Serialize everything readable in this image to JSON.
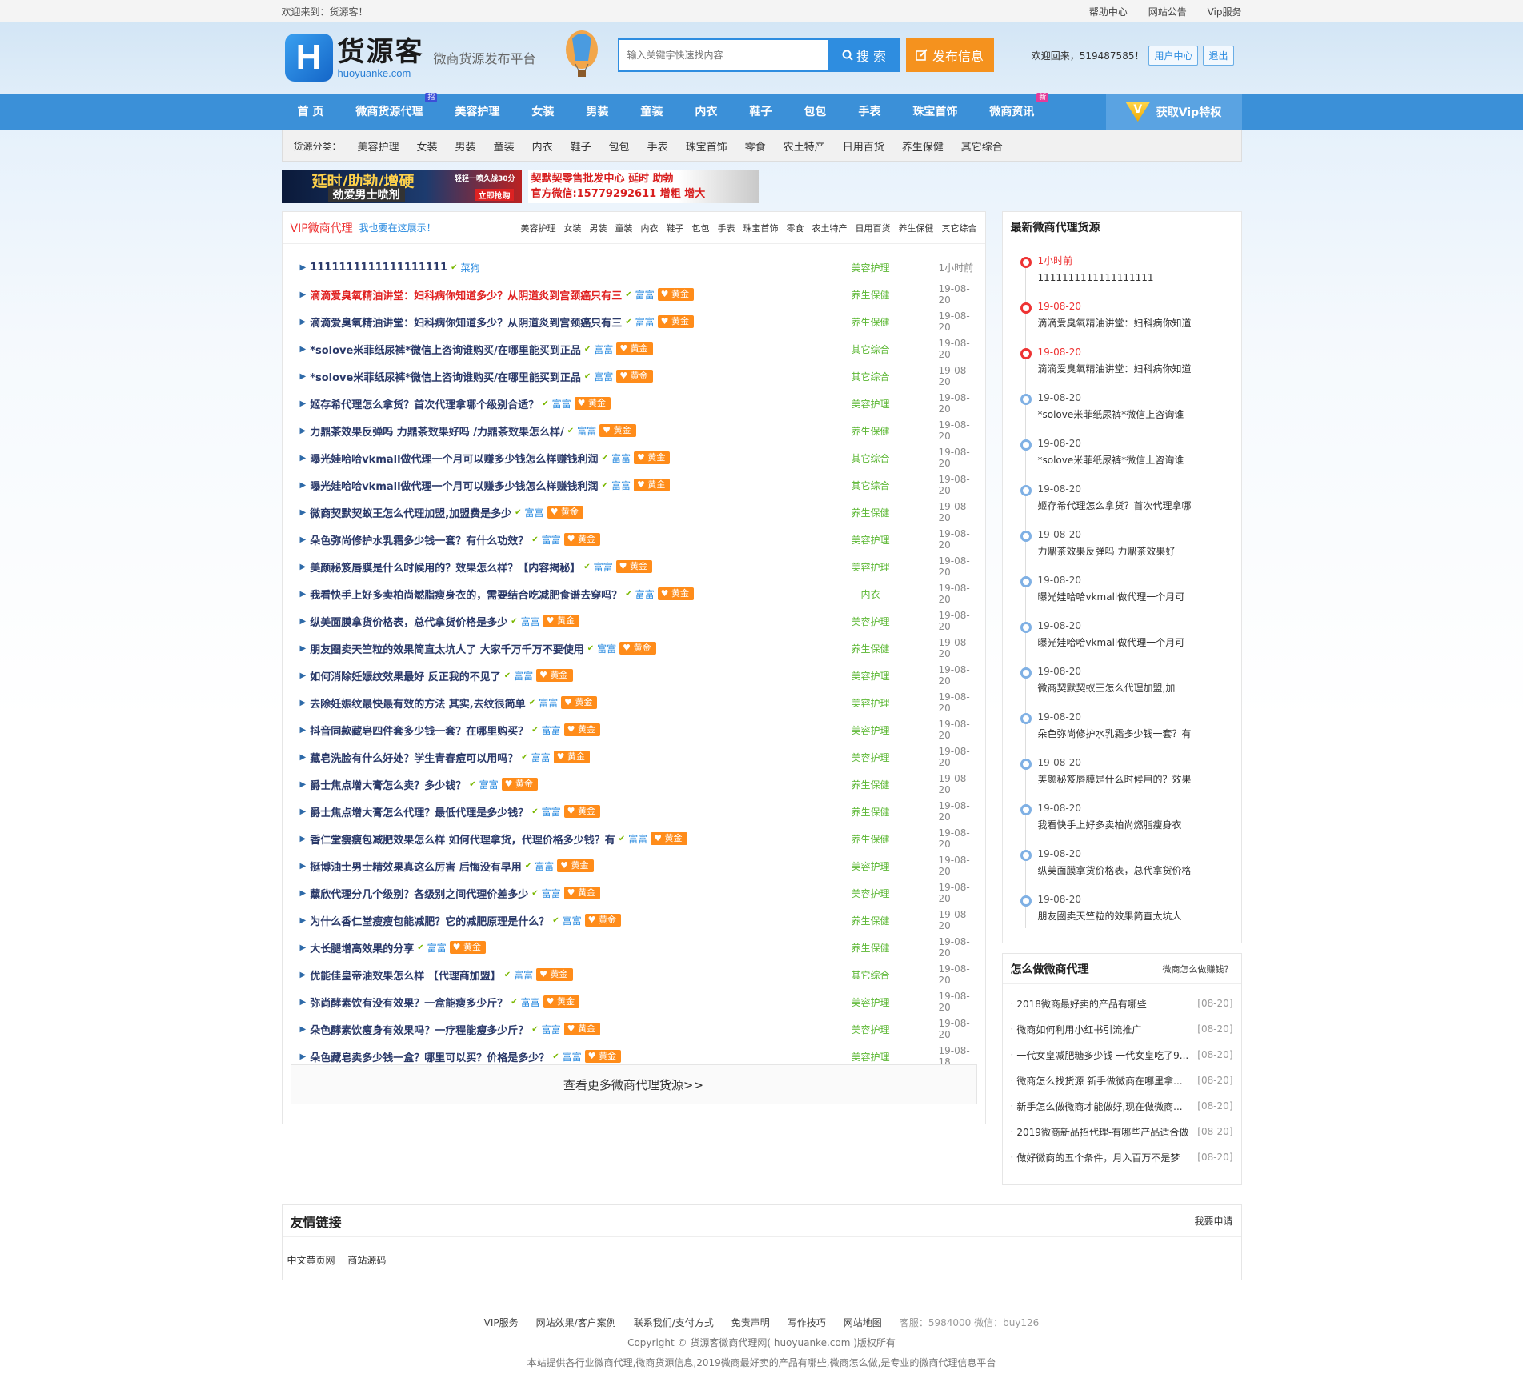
{
  "topbar": {
    "welcome": "欢迎来到：货源客！",
    "links": [
      "帮助中心",
      "网站公告",
      "Vip服务"
    ]
  },
  "header": {
    "logo_letter": "H",
    "logo_cn": "货源客",
    "logo_en": "huoyuanke.com",
    "slogan": "微商货源发布平台",
    "search_placeholder": "输入关键字快速找内容",
    "search_label": "搜 索",
    "publish_label": "发布信息",
    "welcome_user": "欢迎回来，519487585！",
    "user_center": "用户中心",
    "logout": "退出"
  },
  "nav": {
    "items": [
      {
        "label": "首 页",
        "tag": ""
      },
      {
        "label": "微商货源代理",
        "tag": "招"
      },
      {
        "label": "美容护理",
        "tag": ""
      },
      {
        "label": "女装",
        "tag": ""
      },
      {
        "label": "男装",
        "tag": ""
      },
      {
        "label": "童装",
        "tag": ""
      },
      {
        "label": "内衣",
        "tag": ""
      },
      {
        "label": "鞋子",
        "tag": ""
      },
      {
        "label": "包包",
        "tag": ""
      },
      {
        "label": "手表",
        "tag": ""
      },
      {
        "label": "珠宝首饰",
        "tag": ""
      },
      {
        "label": "微商资讯",
        "tag": "新"
      }
    ],
    "vip_label": "获取Vip特权",
    "vip_icon": "V"
  },
  "categories": {
    "label": "货源分类：",
    "items": [
      "美容护理",
      "女装",
      "男装",
      "童装",
      "内衣",
      "鞋子",
      "包包",
      "手表",
      "珠宝首饰",
      "零食",
      "农土特产",
      "日用百货",
      "养生保健",
      "其它综合"
    ]
  },
  "ads": {
    "ad1_main": "延时/助勃/增硬",
    "ad1_sub": "劲爱男士喷剂",
    "ad1_note": "轻轻一喷久战30分",
    "ad1_btn": "立即抢购",
    "ad2_line1": "契默契零售批发中心  延时 助勃",
    "ad2_line2": "官方微信:15779292611 增粗 增大"
  },
  "vip_list": {
    "title": "VIP微商代理",
    "subtitle": "我也要在这展示！",
    "cats": [
      "美容护理",
      "女装",
      "男装",
      "童装",
      "内衣",
      "鞋子",
      "包包",
      "手表",
      "珠宝首饰",
      "零食",
      "农土特产",
      "日用百货",
      "养生保健",
      "其它综合"
    ],
    "rows": [
      {
        "title": "1111111111111111111",
        "red": false,
        "level": "菜狗",
        "gold": "",
        "cat": "美容护理",
        "date": "1小时前"
      },
      {
        "title": "滴滴爱臭氧精油讲堂：妇科病你知道多少？从阴道炎到宫颈癌只有三",
        "red": true,
        "level": "富富",
        "gold": "黄金",
        "cat": "养生保健",
        "date": "19-08-20"
      },
      {
        "title": "滴滴爱臭氧精油讲堂：妇科病你知道多少？从阴道炎到宫颈癌只有三",
        "red": false,
        "level": "富富",
        "gold": "黄金",
        "cat": "养生保健",
        "date": "19-08-20"
      },
      {
        "title": "*solove米菲纸尿裤*微信上咨询谁购买/在哪里能买到正品",
        "red": false,
        "level": "富富",
        "gold": "黄金",
        "cat": "其它综合",
        "date": "19-08-20"
      },
      {
        "title": "*solove米菲纸尿裤*微信上咨询谁购买/在哪里能买到正品",
        "red": false,
        "level": "富富",
        "gold": "黄金",
        "cat": "其它综合",
        "date": "19-08-20"
      },
      {
        "title": "姬存希代理怎么拿货？首次代理拿哪个级别合适？",
        "red": false,
        "level": "富富",
        "gold": "黄金",
        "cat": "美容护理",
        "date": "19-08-20"
      },
      {
        "title": "力鼎茶效果反弹吗 力鼎茶效果好吗 /力鼎茶效果怎么样/",
        "red": false,
        "level": "富富",
        "gold": "黄金",
        "cat": "养生保健",
        "date": "19-08-20"
      },
      {
        "title": "曝光娃哈哈vkmall做代理一个月可以赚多少钱怎么样赚钱利润",
        "red": false,
        "level": "富富",
        "gold": "黄金",
        "cat": "其它综合",
        "date": "19-08-20"
      },
      {
        "title": "曝光娃哈哈vkmall做代理一个月可以赚多少钱怎么样赚钱利润",
        "red": false,
        "level": "富富",
        "gold": "黄金",
        "cat": "其它综合",
        "date": "19-08-20"
      },
      {
        "title": "微商契默契蚁王怎么代理加盟,加盟费是多少",
        "red": false,
        "level": "富富",
        "gold": "黄金",
        "cat": "养生保健",
        "date": "19-08-20"
      },
      {
        "title": "朵色弥尚修护水乳霜多少钱一套？有什么功效？",
        "red": false,
        "level": "富富",
        "gold": "黄金",
        "cat": "美容护理",
        "date": "19-08-20"
      },
      {
        "title": "美颜秘笈唇膜是什么时候用的？效果怎么样？【内容揭秘】",
        "red": false,
        "level": "富富",
        "gold": "黄金",
        "cat": "美容护理",
        "date": "19-08-20"
      },
      {
        "title": "我看快手上好多卖柏尚燃脂瘦身衣的，需要结合吃减肥食谱去穿吗？",
        "red": false,
        "level": "富富",
        "gold": "黄金",
        "cat": "内衣",
        "date": "19-08-20"
      },
      {
        "title": "纵美面膜拿货价格表，总代拿货价格是多少",
        "red": false,
        "level": "富富",
        "gold": "黄金",
        "cat": "美容护理",
        "date": "19-08-20"
      },
      {
        "title": "朋友圈卖天竺粒的效果简直太坑人了 大家千万千万不要使用",
        "red": false,
        "level": "富富",
        "gold": "黄金",
        "cat": "养生保健",
        "date": "19-08-20"
      },
      {
        "title": "如何消除妊娠纹效果最好 反正我的不见了",
        "red": false,
        "level": "富富",
        "gold": "黄金",
        "cat": "美容护理",
        "date": "19-08-20"
      },
      {
        "title": "去除妊娠纹最快最有效的方法 其实,去纹很简单",
        "red": false,
        "level": "富富",
        "gold": "黄金",
        "cat": "美容护理",
        "date": "19-08-20"
      },
      {
        "title": "抖音同款藏皂四件套多少钱一套？在哪里购买？",
        "red": false,
        "level": "富富",
        "gold": "黄金",
        "cat": "美容护理",
        "date": "19-08-20"
      },
      {
        "title": "藏皂洗脸有什么好处？学生青春痘可以用吗？",
        "red": false,
        "level": "富富",
        "gold": "黄金",
        "cat": "美容护理",
        "date": "19-08-20"
      },
      {
        "title": "爵士焦点增大膏怎么卖？多少钱？",
        "red": false,
        "level": "富富",
        "gold": "黄金",
        "cat": "养生保健",
        "date": "19-08-20"
      },
      {
        "title": "爵士焦点增大膏怎么代理？最低代理是多少钱？",
        "red": false,
        "level": "富富",
        "gold": "黄金",
        "cat": "养生保健",
        "date": "19-08-20"
      },
      {
        "title": "香仁堂瘦瘦包减肥效果怎么样 如何代理拿货，代理价格多少钱？有",
        "red": false,
        "level": "富富",
        "gold": "黄金",
        "cat": "养生保健",
        "date": "19-08-20"
      },
      {
        "title": "挺博油士男士精效果真这么厉害 后悔没有早用",
        "red": false,
        "level": "富富",
        "gold": "黄金",
        "cat": "美容护理",
        "date": "19-08-20"
      },
      {
        "title": "薰欣代理分几个级别？各级别之间代理价差多少",
        "red": false,
        "level": "富富",
        "gold": "黄金",
        "cat": "美容护理",
        "date": "19-08-20"
      },
      {
        "title": "为什么香仁堂瘦瘦包能减肥？它的减肥原理是什么？",
        "red": false,
        "level": "富富",
        "gold": "黄金",
        "cat": "养生保健",
        "date": "19-08-20"
      },
      {
        "title": "大长腿增高效果的分享",
        "red": false,
        "level": "富富",
        "gold": "黄金",
        "cat": "养生保健",
        "date": "19-08-20"
      },
      {
        "title": "优能佳皇帝油效果怎么样 【代理商加盟】",
        "red": false,
        "level": "富富",
        "gold": "黄金",
        "cat": "其它综合",
        "date": "19-08-20"
      },
      {
        "title": "弥尚酵素饮有没有效果？一盒能瘦多少斤？",
        "red": false,
        "level": "富富",
        "gold": "黄金",
        "cat": "美容护理",
        "date": "19-08-20"
      },
      {
        "title": "朵色酵素饮瘦身有效果吗？一疗程能瘦多少斤？",
        "red": false,
        "level": "富富",
        "gold": "黄金",
        "cat": "美容护理",
        "date": "19-08-20"
      },
      {
        "title": "朵色藏皂卖多少钱一盒？哪里可以买？价格是多少？",
        "red": false,
        "level": "富富",
        "gold": "黄金",
        "cat": "美容护理",
        "date": "19-08-18"
      }
    ],
    "more_label": "查看更多微商代理货源>>"
  },
  "latest": {
    "title": "最新微商代理货源",
    "items": [
      {
        "date": "1小时前",
        "text": "1111111111111111111",
        "red": true
      },
      {
        "date": "19-08-20",
        "text": "滴滴爱臭氧精油讲堂：妇科病你知道",
        "red": true
      },
      {
        "date": "19-08-20",
        "text": "滴滴爱臭氧精油讲堂：妇科病你知道",
        "red": true
      },
      {
        "date": "19-08-20",
        "text": "*solove米菲纸尿裤*微信上咨询谁",
        "red": false
      },
      {
        "date": "19-08-20",
        "text": "*solove米菲纸尿裤*微信上咨询谁",
        "red": false
      },
      {
        "date": "19-08-20",
        "text": "姬存希代理怎么拿货？首次代理拿哪",
        "red": false
      },
      {
        "date": "19-08-20",
        "text": "力鼎茶效果反弹吗 力鼎茶效果好",
        "red": false
      },
      {
        "date": "19-08-20",
        "text": "曝光娃哈哈vkmall做代理一个月可",
        "red": false
      },
      {
        "date": "19-08-20",
        "text": "曝光娃哈哈vkmall做代理一个月可",
        "red": false
      },
      {
        "date": "19-08-20",
        "text": "微商契默契蚁王怎么代理加盟,加",
        "red": false
      },
      {
        "date": "19-08-20",
        "text": "朵色弥尚修护水乳霜多少钱一套？有",
        "red": false
      },
      {
        "date": "19-08-20",
        "text": "美颜秘笈唇膜是什么时候用的？效果",
        "red": false
      },
      {
        "date": "19-08-20",
        "text": "我看快手上好多卖柏尚燃脂瘦身衣",
        "red": false
      },
      {
        "date": "19-08-20",
        "text": "纵美面膜拿货价格表，总代拿货价格",
        "red": false
      },
      {
        "date": "19-08-20",
        "text": "朋友圈卖天竺粒的效果简直太坑人",
        "red": false
      }
    ]
  },
  "howto": {
    "title": "怎么做微商代理",
    "more": "微商怎么做赚钱？",
    "items": [
      {
        "text": "2018微商最好卖的产品有哪些",
        "date": "[08-20]"
      },
      {
        "text": "微商如何利用小红书引流推广",
        "date": "[08-20]"
      },
      {
        "text": "一代女皇减肥糖多少钱 一代女皇吃了9...",
        "date": "[08-20]"
      },
      {
        "text": "微商怎么找货源 新手做微商在哪里拿...",
        "date": "[08-20]"
      },
      {
        "text": "新手怎么做微商才能做好,现在做微商...",
        "date": "[08-20]"
      },
      {
        "text": "2019微商新品招代理-有哪些产品适合做",
        "date": "[08-20]"
      },
      {
        "text": "做好微商的五个条件，月入百万不是梦",
        "date": "[08-20]"
      }
    ]
  },
  "friends": {
    "title": "友情链接",
    "apply": "我要申请",
    "links": [
      "中文黄页网",
      "商站源码"
    ]
  },
  "footer": {
    "links": [
      "VIP服务",
      "网站效果/客户案例",
      "联系我们/支付方式",
      "免责声明",
      "写作技巧",
      "网站地图"
    ],
    "service": "客服：5984000 微信：buy126",
    "copyright": "Copyright © 货源客微商代理网( huoyuanke.com )版权所有",
    "desc": "本站提供各行业微商代理,微商货源信息,2019微商最好卖的产品有哪些,微商怎么做,是专业的微商代理信息平台"
  }
}
